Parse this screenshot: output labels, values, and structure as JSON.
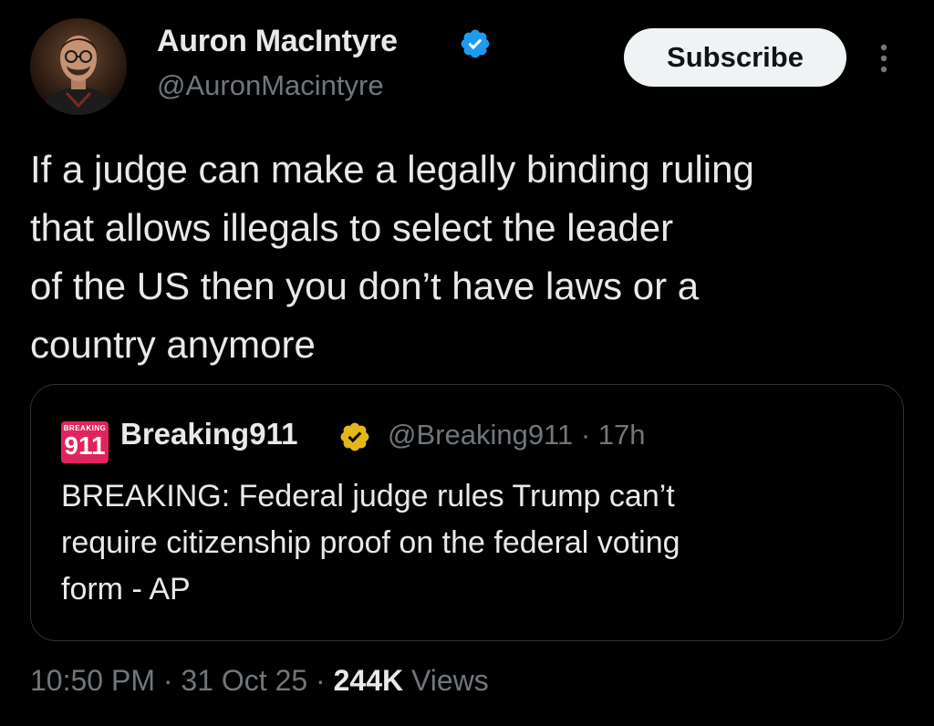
{
  "author": {
    "name": "Auron MacIntyre",
    "handle": "@AuronMacintyre"
  },
  "subscribe_label": "Subscribe",
  "tweet_text": "If a judge can make a legally binding ruling\nthat allows illegals to select the leader\nof the US then you don’t have laws or a\ncountry anymore",
  "quote": {
    "logo_small": "BREAKING",
    "logo_big": "911",
    "name": "Breaking911",
    "handle_time": "@Breaking911 · 17h",
    "text": "BREAKING: Federal judge rules Trump can’t\nrequire citizenship proof on the federal voting\nform - AP"
  },
  "meta": {
    "time": "10:50 PM",
    "sep1": " · ",
    "date": "31 Oct 25",
    "sep2": " · ",
    "views_count": "244K",
    "views_label": " Views"
  },
  "colors": {
    "background": "#000000",
    "text": "#e7e9ea",
    "secondary": "#71767b",
    "verified_blue": "#1d9bf0",
    "verified_gold": "#e2b719",
    "border": "#2f3336"
  },
  "icons": [
    "verified-icon",
    "more-icon",
    "gold-verified-icon"
  ]
}
